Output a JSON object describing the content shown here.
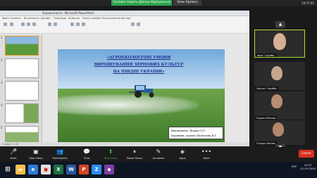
{
  "zoom": {
    "share_banner": "Чоловік ловить Данни Відіграєнна",
    "view_options": "View Options",
    "top_status": "10:57:01",
    "participants": [
      {
        "name": "Іван Гліреба"
      },
      {
        "name": "Орган Гліреба"
      },
      {
        "name": "Україн Віника"
      },
      {
        "name": "Гіндел Бізнес"
      }
    ],
    "toolbar": [
      {
        "label": "Mute",
        "icon": "mic-icon"
      },
      {
        "label": "Stop Video",
        "icon": "video-icon"
      },
      {
        "label": "Participants",
        "icon": "participants-icon"
      },
      {
        "label": "Chat",
        "icon": "chat-icon"
      },
      {
        "label": "New Share",
        "icon": "share-icon"
      },
      {
        "label": "Pause Share",
        "icon": "pause-icon"
      },
      {
        "label": "Annotate",
        "icon": "annotate-icon"
      },
      {
        "label": "Apps",
        "icon": "apps-icon"
      },
      {
        "label": "More",
        "icon": "more-icon"
      }
    ],
    "end_label": "Leave"
  },
  "ppt": {
    "title": "Агроекологія - Microsoft PowerPoint",
    "tabs": [
      "Файл",
      "Основне",
      "Вставлення",
      "Дизайн",
      "Переходи",
      "Анімація",
      "Показ слайдів",
      "Рецензування",
      "Вигляд"
    ],
    "thumb_numbers": [
      "1",
      "2",
      "3",
      "4",
      "5"
    ],
    "status": "Слайд 1 з 24",
    "slide": {
      "title_lines": [
        "«АГРОЕКОЛОГІЧНІ УМОВИ",
        "ВИРОЩУВАННЯ ЗЕРНОВИХ КУЛЬТУР",
        "НА ПІВДНІ УКРАЇНИ»"
      ],
      "author_lines": [
        "Виконавець: Шадра О.Р.",
        "Керівник: доцент Шепелєва В.Г."
      ]
    }
  },
  "taskbar": {
    "lang": "УКР",
    "time": "10:57",
    "date": "22.05.2020"
  }
}
